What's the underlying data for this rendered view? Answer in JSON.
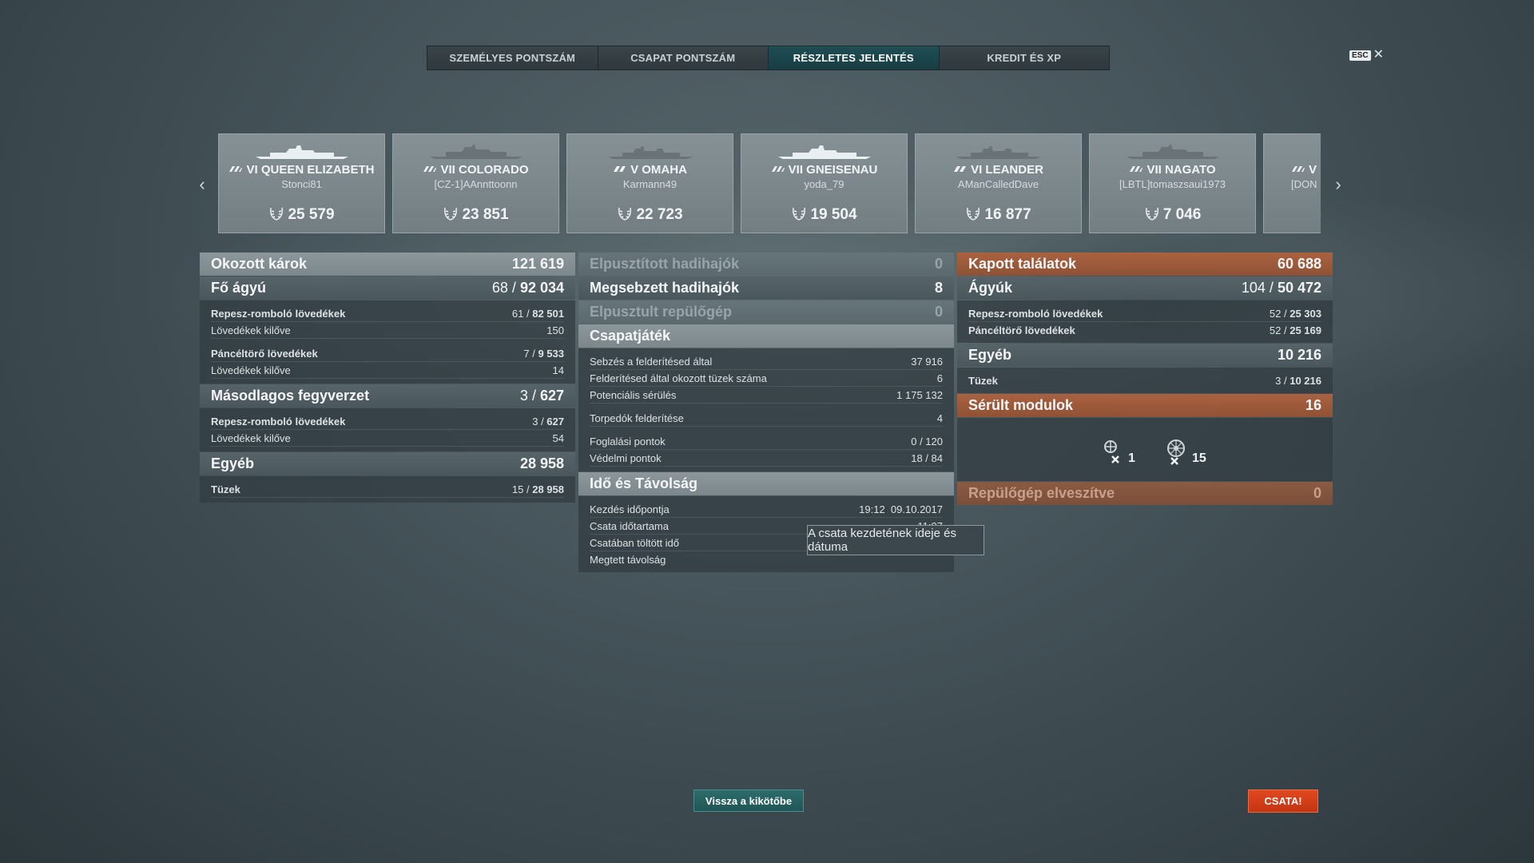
{
  "tabs": [
    {
      "label": "SZEMÉLYES PONTSZÁM",
      "active": false
    },
    {
      "label": "CSAPAT PONTSZÁM",
      "active": false
    },
    {
      "label": "RÉSZLETES JELENTÉS",
      "active": true
    },
    {
      "label": "KREDIT ÉS XP",
      "active": false
    }
  ],
  "esc_label": "ESC",
  "ships": [
    {
      "name": "VI QUEEN ELIZABETH",
      "player": "Stonci81",
      "score": "25 579"
    },
    {
      "name": "VII COLORADO",
      "player": "[CZ-1]AAnnttoonn",
      "score": "23 851"
    },
    {
      "name": "V OMAHA",
      "player": "Karmann49",
      "score": "22 723"
    },
    {
      "name": "VII GNEISENAU",
      "player": "yoda_79",
      "score": "19 504"
    },
    {
      "name": "VI LEANDER",
      "player": "AManCalledDave",
      "score": "16 877"
    },
    {
      "name": "VII NAGATO",
      "player": "[LBTL]tomaszsaui1973",
      "score": "7 046"
    },
    {
      "name": "V",
      "player": "[DON",
      "score": ""
    }
  ],
  "left": {
    "dealt": {
      "label": "Okozott károk",
      "value": "121 619"
    },
    "main": {
      "label": "Fő ágyú",
      "hits": "68",
      "value": "92 034"
    },
    "main_he": {
      "label": "Repesz-romboló lövedékek",
      "hits": "61",
      "value": "82 501"
    },
    "main_he_fired": {
      "label": "Lövedékek kilőve",
      "value": "150"
    },
    "main_ap": {
      "label": "Páncéltörő lövedékek",
      "hits": "7",
      "value": "9 533"
    },
    "main_ap_fired": {
      "label": "Lövedékek kilőve",
      "value": "14"
    },
    "secondary": {
      "label": "Másodlagos fegyverzet",
      "hits": "3",
      "value": "627"
    },
    "sec_he": {
      "label": "Repesz-romboló lövedékek",
      "hits": "3",
      "value": "627"
    },
    "sec_he_fired": {
      "label": "Lövedékek kilőve",
      "value": "54"
    },
    "other": {
      "label": "Egyéb",
      "value": "28 958"
    },
    "fires": {
      "label": "Tüzek",
      "hits": "15",
      "value": "28 958"
    }
  },
  "middle": {
    "destroyed": {
      "label": "Elpusztított hadihajók",
      "value": "0"
    },
    "damaged": {
      "label": "Megsebzett hadihajók",
      "value": "8"
    },
    "planes": {
      "label": "Elpusztult repülőgép",
      "value": "0"
    },
    "team": {
      "label": "Csapatjáték"
    },
    "team_rows": [
      {
        "label": "Sebzés a felderítésed által",
        "value": "37 916"
      },
      {
        "label": "Felderítésed által okozott tüzek száma",
        "value": "6"
      },
      {
        "label": "Potenciális sérülés",
        "value": "1 175 132"
      },
      {
        "label": "Torpedók felderítése",
        "value": "4"
      },
      {
        "label": "Foglalási pontok",
        "value": "0 / 120"
      },
      {
        "label": "Védelmi pontok",
        "value": "18 / 84"
      }
    ],
    "time": {
      "label": "Idő és Távolság"
    },
    "time_rows": [
      {
        "label": "Kezdés időpontja",
        "value": "19:12  09.10.2017"
      },
      {
        "label": "Csata időtartama",
        "value": "11:07"
      },
      {
        "label": "Csatában töltött idő",
        "value": ""
      },
      {
        "label": "Megtett távolság",
        "value": ""
      }
    ]
  },
  "right": {
    "received": {
      "label": "Kapott találatok",
      "value": "60 688"
    },
    "guns": {
      "label": "Ágyúk",
      "hits": "104",
      "value": "50 472"
    },
    "he": {
      "label": "Repesz-romboló lövedékek",
      "hits": "52",
      "value": "25 303"
    },
    "ap": {
      "label": "Páncéltörő lövedékek",
      "hits": "52",
      "value": "25 169"
    },
    "other": {
      "label": "Egyéb",
      "value": "10 216"
    },
    "fires": {
      "label": "Tüzek",
      "hits": "3",
      "value": "10 216"
    },
    "modules": {
      "label": "Sérült modulok",
      "value": "16"
    },
    "module_counts": [
      {
        "icon": "steering-gear-icon",
        "count": "1"
      },
      {
        "icon": "engine-icon",
        "count": "15"
      }
    ],
    "planes_lost": {
      "label": "Repülőgép elveszítve",
      "value": "0"
    }
  },
  "tooltip": "A csata kezdetének ideje és dátuma",
  "buttons": {
    "back": "Vissza a kikötőbe",
    "battle": "CSATA!"
  },
  "colors": {
    "accent_teal": "#1f4e55",
    "battle_orange": "#d83f18",
    "received_orange": "#a05c3c"
  }
}
